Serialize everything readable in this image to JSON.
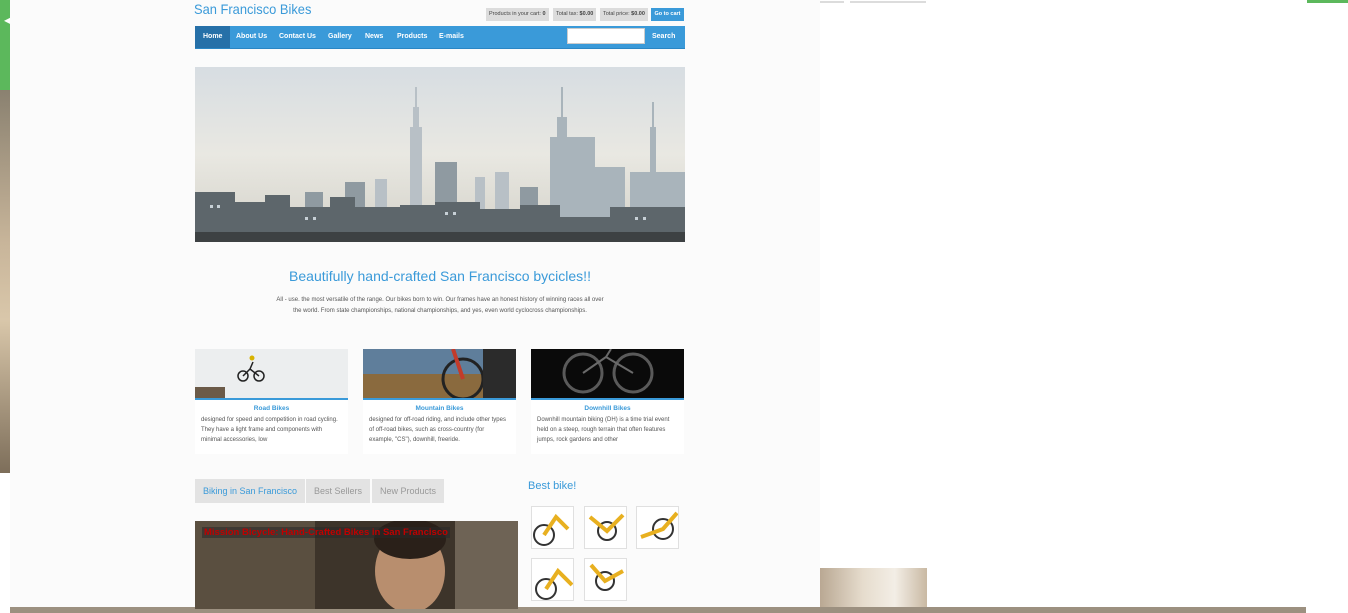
{
  "site": {
    "title": "San Francisco Bikes"
  },
  "cart": {
    "products_label": "Products in your cart:",
    "products_count": "0",
    "tax_label": "Total tax:",
    "tax_value": "$0.00",
    "price_label": "Total price:",
    "price_value": "$0.00",
    "go_label": "Go to cart"
  },
  "nav": {
    "items": [
      "Home",
      "About Us",
      "Contact Us",
      "Gallery",
      "News",
      "Products",
      "E-mails"
    ],
    "active": "Home",
    "search_placeholder": "",
    "search_label": "Search"
  },
  "hero": {
    "scene": "city skyline"
  },
  "headline": "Beautifully hand-crafted San Francisco bycicles!!",
  "intro": "All - use. the most versatile of the range. Our bikes born to win. Our frames have an honest history of winning races all over the world. From state championships, national championships, and yes, even world cyclocross championships.",
  "categories": [
    {
      "title": "Road Bikes",
      "text": "designed for speed and competition in road cycling. They have a light frame and components with minimal accessories, low"
    },
    {
      "title": "Mountain Bikes",
      "text": "designed for off-road riding, and include other types of off-road bikes, such as cross-country (for example, \"CS\"), downhill, freeride."
    },
    {
      "title": "Downhill Bikes",
      "text": "Downhill mountain biking (DH) is a time trial event held on a steep, rough terrain that often features jumps, rock gardens and other"
    }
  ],
  "tabs": [
    "Biking in San Francisco",
    "Best Sellers",
    "New Products"
  ],
  "active_tab": "Biking in San Francisco",
  "feature": {
    "caption": "Mission Bicycle: Hand-Crafted Bikes in San Francisco"
  },
  "best": {
    "title": "Best bike!"
  },
  "colors": {
    "accent": "#3a9ad9",
    "nav_active": "#2670a8",
    "feature_caption": "#c00000"
  }
}
